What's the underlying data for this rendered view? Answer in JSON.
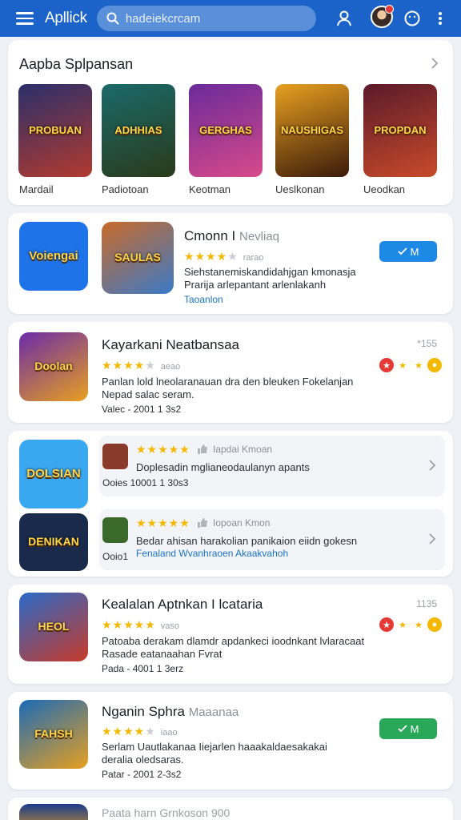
{
  "header": {
    "brand": "Apllick",
    "search_placeholder": "hadeiekcrcam"
  },
  "featured": {
    "title": "Aapba Splpansan",
    "tiles": [
      {
        "art": "PROBUAN",
        "label": "Mardail",
        "colors": [
          "#2a2f6b",
          "#b23a2f"
        ]
      },
      {
        "art": "ADHHIAS",
        "label": "Padiotoan",
        "colors": [
          "#1a6a6a",
          "#2a3a1a"
        ]
      },
      {
        "art": "GERGHAS",
        "label": "Keotman",
        "colors": [
          "#6a2a9a",
          "#d84a8a"
        ]
      },
      {
        "art": "NAUSHIGAS",
        "label": "Ueslkonan",
        "colors": [
          "#e8a020",
          "#3a1a0a"
        ]
      },
      {
        "art": "PROPDAN",
        "label": "Ueodkan",
        "colors": [
          "#5a1a2a",
          "#c84a2a"
        ]
      }
    ]
  },
  "apps": [
    {
      "logo": "Voiengai",
      "logo_bg": "#1e73e8",
      "icon": "SAULAS",
      "icon_colors": [
        "#c96a2a",
        "#3a7ac8"
      ],
      "title": "Cmonn I",
      "title_sub": "Nevliaq",
      "rating_text": "rarao",
      "desc1": "Siehstanemiskandidahjgan kmonasja",
      "desc2": "Prarija arlepantant arlenlakanh",
      "link": "Taoanlon",
      "button": "M",
      "button_color": "#1e88e5"
    },
    {
      "icon": "Doolan",
      "icon_colors": [
        "#6a2aa8",
        "#e8a020"
      ],
      "title": "Kayarkani Neatbansaa",
      "rating_text": "aeao",
      "desc1": "Panlan lold lneolaranauan dra den bleuken Fokelanjan",
      "desc2": "Nepad salac seram.",
      "meta": "Valec - 2001 1 3s2",
      "corner": "*155"
    },
    {
      "logo": "DOLSIAN",
      "logo_bg": "#3aa8f0",
      "sub_rows": [
        {
          "thumb": "#8a3a2a",
          "tag": "Iapdai Kmoan",
          "desc": "Doplesadin mglianeodaulanyn apants",
          "meta": "Ooies 10001 1 30s3"
        },
        {
          "thumb": "#3a6a2a",
          "tag": "Iopoan Kmon",
          "desc": "Bedar ahisan harakolian panikaion eiidn gokesn",
          "link": "Fenaland Wvanhraoen Akaakvahoh",
          "meta": "Ooio1"
        }
      ],
      "logo2": "DENIKAN",
      "logo2_bg": "#1a2a4a"
    },
    {
      "icon": "HEOL",
      "icon_colors": [
        "#2a6ac8",
        "#c83a2a"
      ],
      "title": "Kealalan Aptnkan I lcataria",
      "rating_text": "vaso",
      "desc1": "Patoaba derakam dlamdr apdankeci ioodnkant lvlaracaat",
      "desc2": "Rasade eatanaahan Fvrat",
      "meta": "Pada - 4001 1 3erz",
      "corner": "1135"
    },
    {
      "icon": "FAHSH",
      "icon_colors": [
        "#1a6ab8",
        "#e8a020"
      ],
      "title": "Nganin Sphra",
      "title_sub": "Maaanaa",
      "rating_text": "iaao",
      "desc1": "Serlam Uautlakanaa Iiejarlen haaakaldaesakakai",
      "desc2": "deralia oledsaras.",
      "meta": "Patar - 2001 2-3s2",
      "button": "M",
      "button_color": "#2aa85a"
    }
  ],
  "footer_peek": {
    "title": "Paata harn Grnkoson",
    "count": "900"
  },
  "colors": {
    "topbar": "#1b63c9",
    "star": "#f5b800",
    "link": "#1a73c8"
  }
}
